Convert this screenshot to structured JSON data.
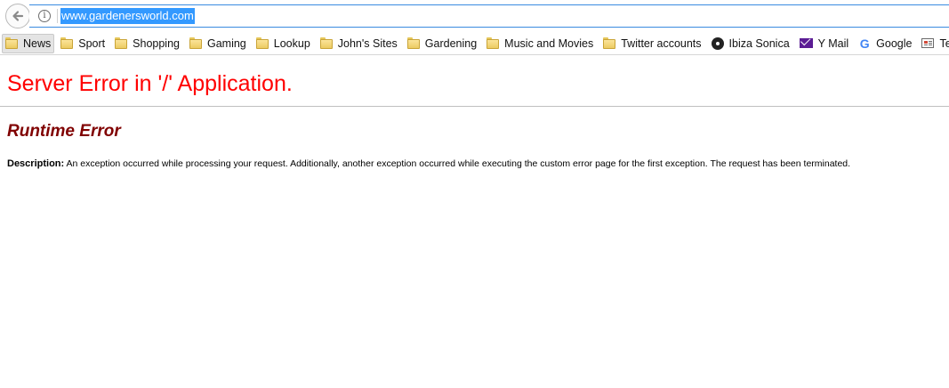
{
  "browser": {
    "url": "www.gardenersworld.com",
    "back_icon": "back-arrow-icon",
    "info_icon_glyph": "i"
  },
  "bookmarks": [
    {
      "label": "News",
      "icon": "folder-icon"
    },
    {
      "label": "Sport",
      "icon": "folder-icon"
    },
    {
      "label": "Shopping",
      "icon": "folder-icon"
    },
    {
      "label": "Gaming",
      "icon": "folder-icon"
    },
    {
      "label": "Lookup",
      "icon": "folder-icon"
    },
    {
      "label": "John's Sites",
      "icon": "folder-icon"
    },
    {
      "label": "Gardening",
      "icon": "folder-icon"
    },
    {
      "label": "Music and Movies",
      "icon": "folder-icon"
    },
    {
      "label": "Twitter accounts",
      "icon": "folder-icon"
    },
    {
      "label": "Ibiza Sonica",
      "icon": "vinyl-icon"
    },
    {
      "label": "Y Mail",
      "icon": "mail-icon"
    },
    {
      "label": "Google",
      "icon": "google-icon",
      "glyph": "G"
    },
    {
      "label": "Technology",
      "icon": "news-icon"
    }
  ],
  "page": {
    "title": "Server Error in '/' Application.",
    "subtitle": "Runtime Error",
    "description_label": "Description:",
    "description_text": "An exception occurred while processing your request. Additionally, another exception occurred while executing the custom error page for the first exception. The request has been terminated."
  },
  "colors": {
    "title": "#ff0000",
    "subtitle": "#800000",
    "url_highlight": "#3399ff",
    "urlbar_border": "#3a8be0"
  }
}
